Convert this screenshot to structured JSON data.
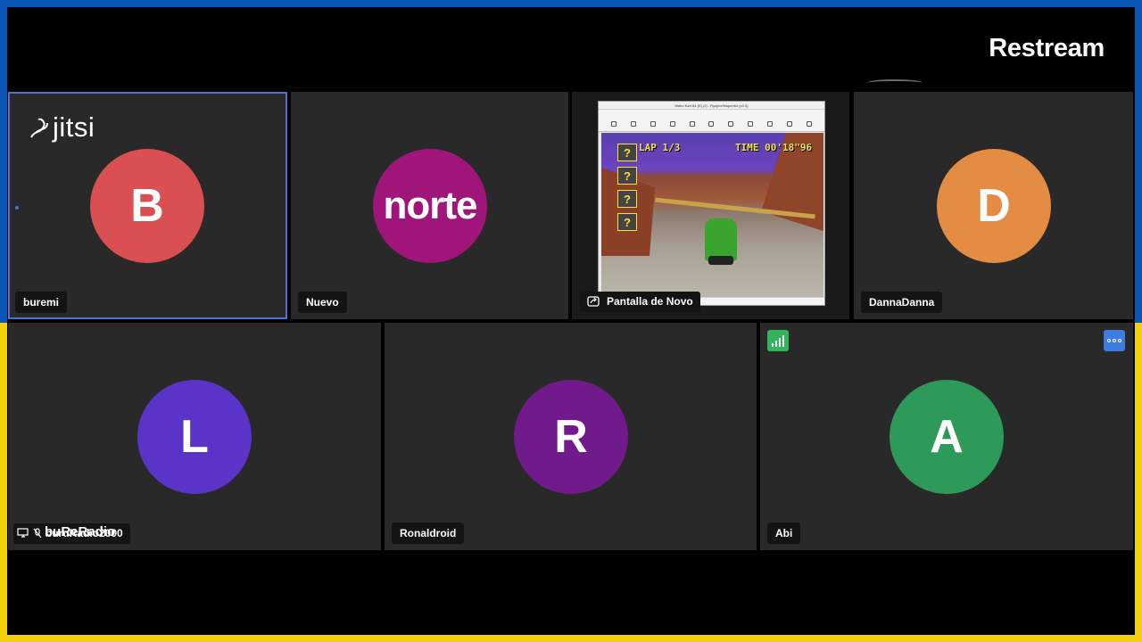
{
  "stream": {
    "brand": "Restream"
  },
  "conference": {
    "logo_text": "jitsi"
  },
  "participants": [
    {
      "name": "buremi",
      "initial": "B",
      "color": "#d94f52"
    },
    {
      "name": "Nuevo",
      "initial": "norte",
      "color": "#a0157a"
    },
    {
      "name": "DannaDanna",
      "initial": "D",
      "color": "#e48b44"
    },
    {
      "name": "buruRadio2000",
      "initial": "L",
      "color": "#5a33c8"
    },
    {
      "name": "Ronaldroid",
      "initial": "R",
      "color": "#701a8c"
    },
    {
      "name": "Abi",
      "initial": "A",
      "color": "#2e9a5a"
    }
  ],
  "screen_share": {
    "label": "Pantalla de Novo",
    "window_title": "Mario Kart 64 (E) (J) - Ryujinx/Mupen64 (v0.0)",
    "hud_lap": "LAP 1/3",
    "hud_time": "TIME 00'18\"96"
  },
  "overlays": {
    "mic_overlay_text": "buReRadio"
  },
  "colors": {
    "frame_top": "#0a57b8",
    "frame_bottom": "#f2d10c",
    "active_border": "#4a75cc",
    "tile_bg": "#292929"
  }
}
